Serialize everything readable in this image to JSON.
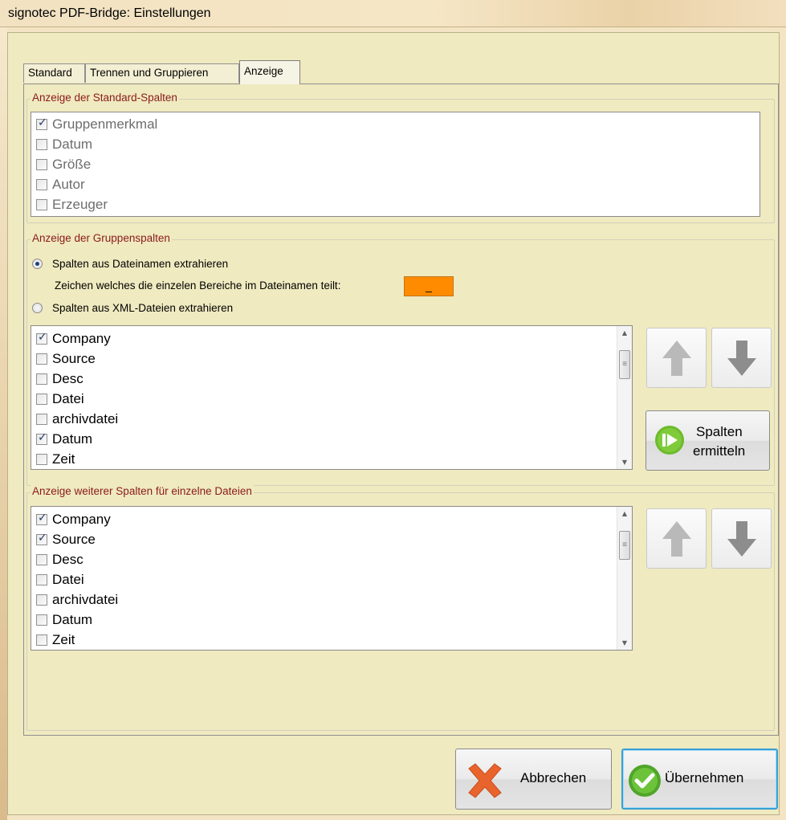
{
  "window": {
    "title": "signotec PDF-Bridge: Einstellungen"
  },
  "tabs": [
    {
      "label": "Standard"
    },
    {
      "label": "Trennen und Gruppieren"
    },
    {
      "label": "Anzeige"
    }
  ],
  "standard_columns": {
    "title": "Anzeige der Standard-Spalten",
    "items": [
      {
        "label": "Gruppenmerkmal",
        "checked": true
      },
      {
        "label": "Datum",
        "checked": false
      },
      {
        "label": "Größe",
        "checked": false
      },
      {
        "label": "Autor",
        "checked": false
      },
      {
        "label": "Erzeuger",
        "checked": false
      }
    ]
  },
  "group_columns": {
    "title": "Anzeige der Gruppenspalten",
    "radio_filename": {
      "label": "Spalten aus Dateinamen extrahieren",
      "selected": true
    },
    "separator_label": "Zeichen welches die einzelen Bereiche im Dateinamen teilt:",
    "separator_value": "_",
    "radio_xml": {
      "label": "Spalten aus XML-Dateien extrahieren",
      "selected": false
    },
    "items": [
      {
        "label": "Company",
        "checked": true
      },
      {
        "label": "Source",
        "checked": false
      },
      {
        "label": "Desc",
        "checked": false
      },
      {
        "label": "Datei",
        "checked": false
      },
      {
        "label": "archivdatei",
        "checked": false
      },
      {
        "label": "Datum",
        "checked": true
      },
      {
        "label": "Zeit",
        "checked": false
      }
    ],
    "determine_button": {
      "line1": "Spalten",
      "line2": "ermitteln"
    }
  },
  "file_columns": {
    "title": "Anzeige weiterer Spalten für einzelne Dateien",
    "items": [
      {
        "label": "Company",
        "checked": true
      },
      {
        "label": "Source",
        "checked": true
      },
      {
        "label": "Desc",
        "checked": false
      },
      {
        "label": "Datei",
        "checked": false
      },
      {
        "label": "archivdatei",
        "checked": false
      },
      {
        "label": "Datum",
        "checked": false
      },
      {
        "label": "Zeit",
        "checked": false
      }
    ]
  },
  "footer": {
    "cancel_label": "Abbrechen",
    "apply_label": "Übernehmen"
  },
  "colors": {
    "group_label": "#8b1a1a",
    "separator_field": "#ff8c00",
    "cancel_icon": "#e8642c",
    "apply_icon": "#5fb631"
  }
}
